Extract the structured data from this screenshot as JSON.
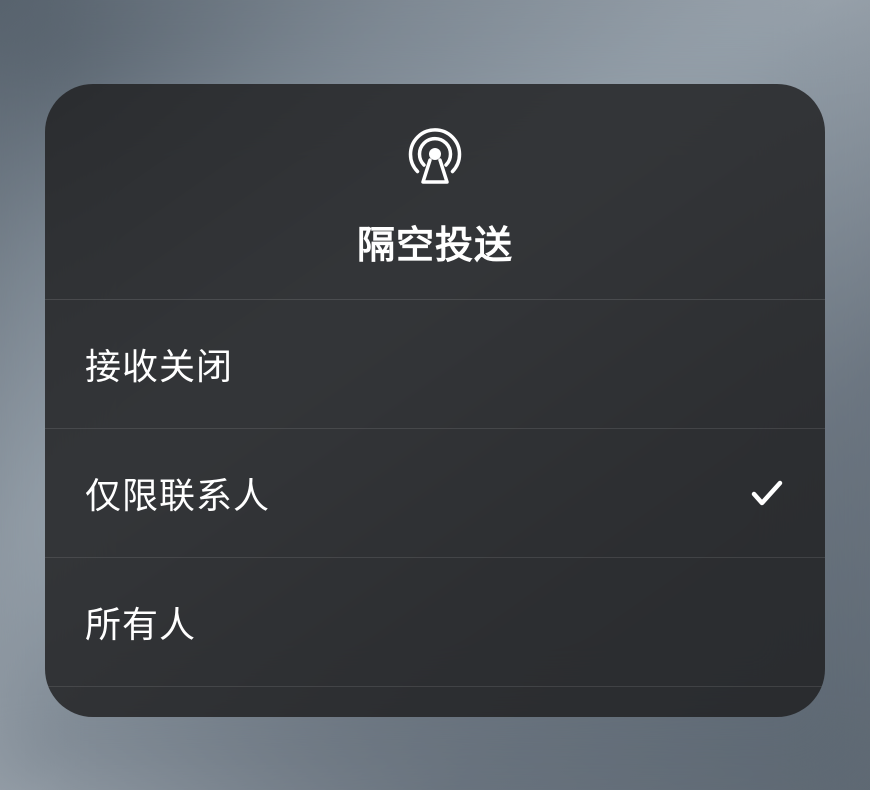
{
  "header": {
    "title": "隔空投送",
    "icon": "airdrop-icon"
  },
  "options": [
    {
      "label": "接收关闭",
      "selected": false
    },
    {
      "label": "仅限联系人",
      "selected": true
    },
    {
      "label": "所有人",
      "selected": false
    }
  ]
}
